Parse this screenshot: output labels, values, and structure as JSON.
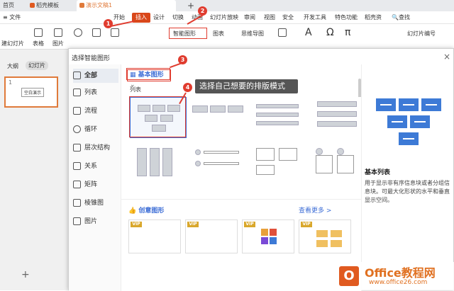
{
  "tabs": [
    "首页",
    "稻壳模板",
    "演示文稿1"
  ],
  "menu": {
    "file": "文件",
    "items": [
      "开始",
      "插入",
      "设计",
      "切换",
      "动画",
      "幻灯片放映",
      "审阅",
      "视图",
      "安全",
      "开发工具",
      "特色功能",
      "稻壳资"
    ],
    "search": "查找"
  },
  "ribbon": {
    "new_slide": "建幻灯片",
    "table": "表格",
    "picture": "图片",
    "smartart": "智能图形",
    "chart": "图表",
    "mindmap": "思维导图",
    "slide_number": "幻灯片编号"
  },
  "left": {
    "outline": "大纲",
    "slides": "幻灯片",
    "slide_text": "空白演示",
    "add": "+"
  },
  "dialog": {
    "title": "选择智能图形",
    "close": "×",
    "categories": [
      "全部",
      "列表",
      "流程",
      "循环",
      "层次结构",
      "关系",
      "矩阵",
      "棱锥图",
      "图片"
    ],
    "dropdown": "基本图形",
    "sub_label": "列表",
    "creative_title": "创意图形",
    "creative_more": "查看更多 >",
    "vip": "VIP",
    "preview_name": "基本列表",
    "preview_desc": "用于显示非有序信息块或者分组信息块。可最大化形状的水平和垂直显示空间。"
  },
  "annotations": {
    "badges": [
      "1",
      "2",
      "3",
      "4"
    ],
    "callout": "选择自己想要的排版模式"
  },
  "watermark": {
    "text": "Office教程网",
    "url": "www.office26.com"
  },
  "colors": {
    "accent_red": "#e03c2f",
    "blue": "#3c6dd6",
    "preview_blue": "#3d7ad6"
  }
}
